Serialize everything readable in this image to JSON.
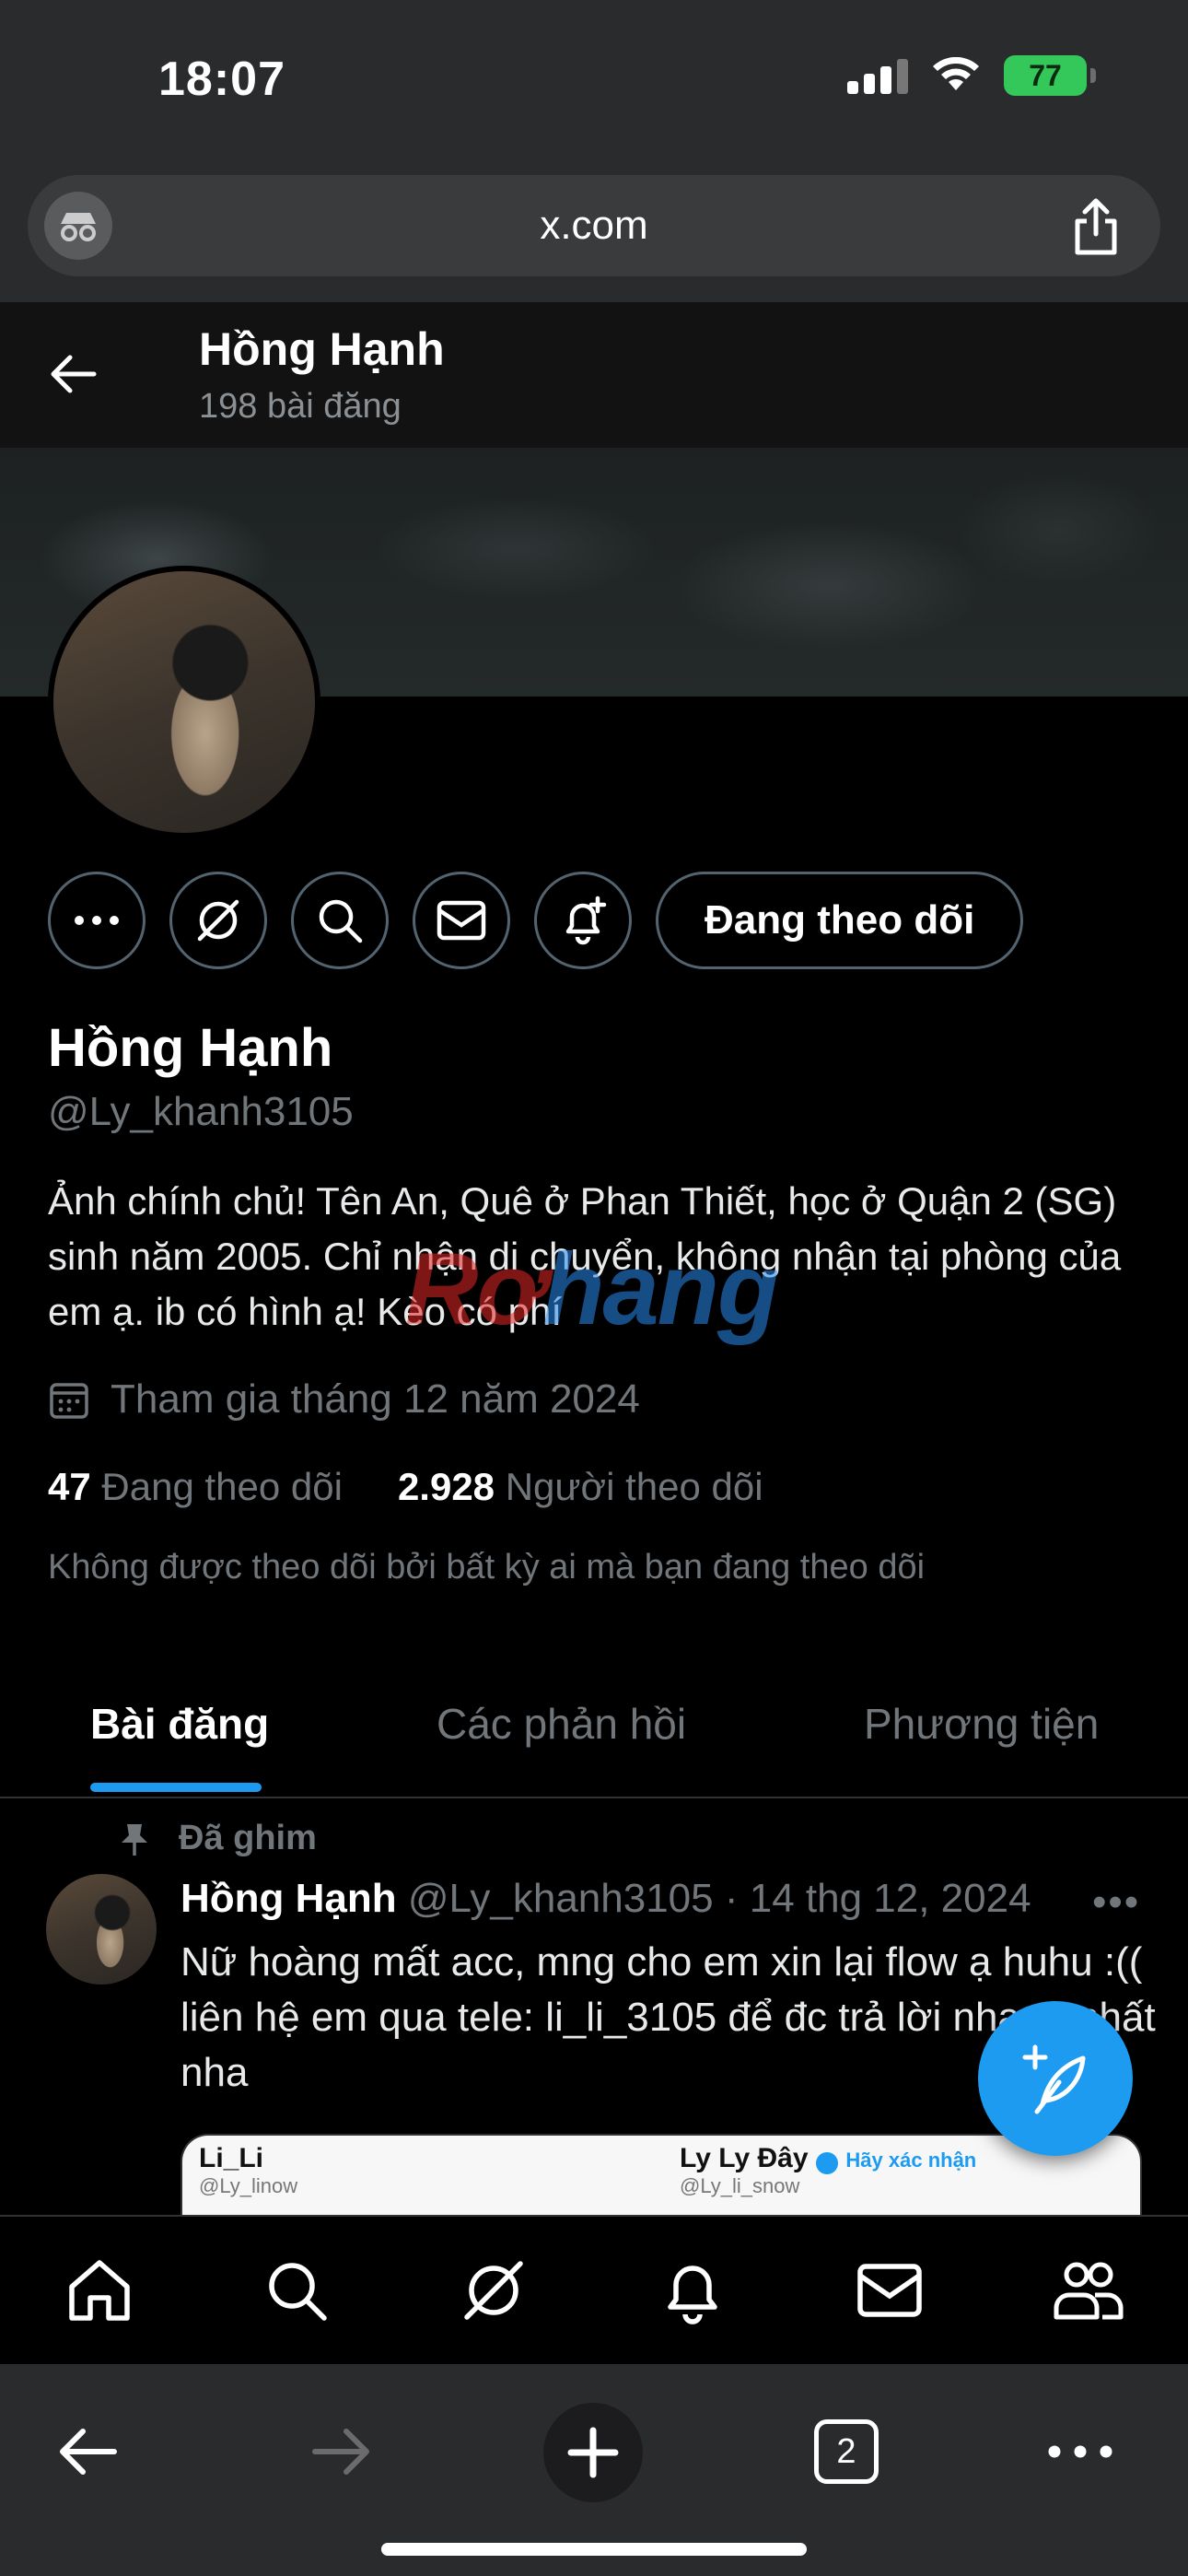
{
  "status_bar": {
    "time": "18:07",
    "battery": "77"
  },
  "browser": {
    "url": "x.com",
    "tab_count": "2"
  },
  "header": {
    "name": "Hồng Hạnh",
    "post_count": "198 bài đăng"
  },
  "profile": {
    "follow_label": "Đang theo dõi",
    "name": "Hồng Hạnh",
    "handle": "@Ly_khanh3105",
    "bio": "Ảnh chính chủ! Tên An, Quê ở Phan Thiết, học ở Quận 2 (SG) sinh năm 2005. Chỉ nhận di chuyển, không nhận tại phòng của em ạ. ib có hình ạ! Kèo có phí",
    "joined": "Tham gia tháng 12 năm 2024",
    "following_count": "47",
    "following_label": "Đang theo dõi",
    "followers_count": "2.928",
    "followers_label": "Người theo dõi",
    "note": "Không được theo dõi bởi bất kỳ ai mà bạn đang theo dõi"
  },
  "watermark": {
    "part1": "Rơ",
    "part2": "hang"
  },
  "tabs": [
    {
      "label": "Bài đăng"
    },
    {
      "label": "Các phản hồi"
    },
    {
      "label": "Phương tiện"
    }
  ],
  "post": {
    "pinned_label": "Đã ghim",
    "author": "Hồng Hạnh",
    "meta": "@Ly_khanh3105 · 14 thg 12, 2024",
    "text": "Nữ hoàng mất acc, mng cho em xin lại flow ạ huhu :(( liên hệ em qua tele: li_li_3105 để đc trả lời nhanh nhất nha",
    "embed": {
      "left_name": "Li_Li",
      "left_handle": "@Ly_linow",
      "right_name": "Ly Ly Đây",
      "right_verify": "Hãy xác nhận",
      "right_handle": "@Ly_li_snow"
    }
  },
  "colors": {
    "accent": "#1d9bf0",
    "background": "#000000",
    "muted": "#71767b"
  }
}
